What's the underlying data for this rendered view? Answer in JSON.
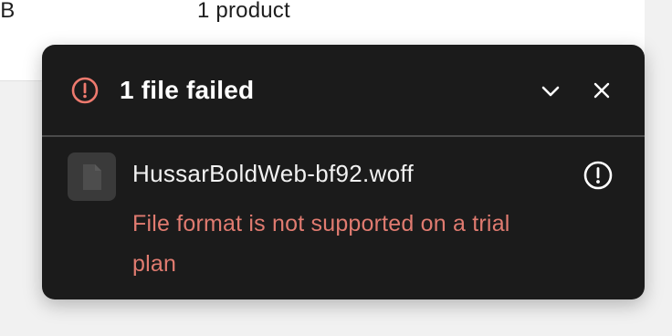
{
  "background": {
    "size_text": "MB",
    "product_count": "1 product"
  },
  "toast": {
    "title": "1 file failed",
    "icons": {
      "header": "error-circle-icon",
      "collapse": "chevron-down-icon",
      "close": "close-icon",
      "file": "file-icon",
      "row": "alert-circle-icon"
    },
    "files": [
      {
        "name": "HussarBoldWeb-bf92.woff",
        "error": "File format is not supported on a trial plan"
      }
    ]
  },
  "colors": {
    "toast_bg": "#1b1b1b",
    "error_text": "#e07b70",
    "error_icon": "#ee7a6e",
    "page_bg": "#f1f1f1"
  }
}
